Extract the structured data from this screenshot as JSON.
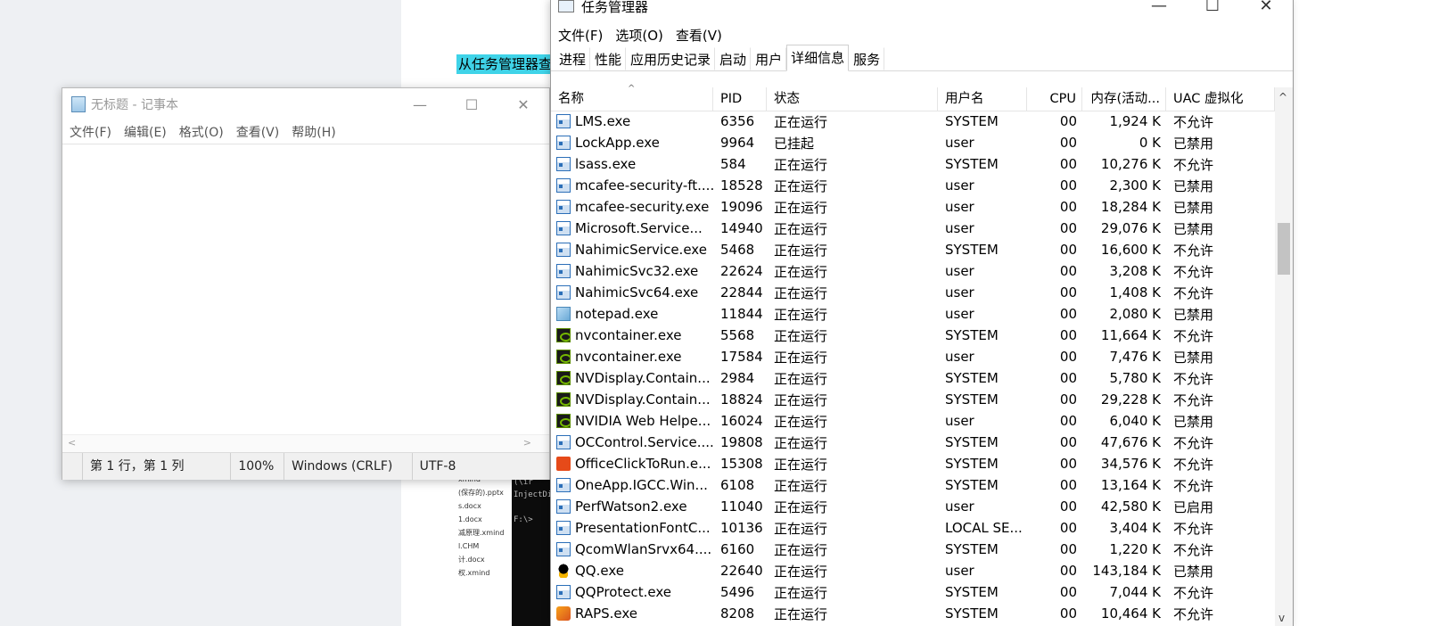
{
  "background": {
    "doc_highlight": "从任务管理器查",
    "files": [
      "xmind",
      "(保存的).pptx",
      "s.docx",
      "1.docx",
      "减原理.xmind",
      "l.CHM",
      "计.docx",
      "权.xmind"
    ],
    "console_lines": [
      "(\\ir",
      "InjectDi",
      "",
      "F:\\>"
    ]
  },
  "notepad": {
    "title": "无标题 - 记事本",
    "menu": [
      "文件(F)",
      "编辑(E)",
      "格式(O)",
      "查看(V)",
      "帮助(H)"
    ],
    "status": {
      "position": "第 1 行，第 1 列",
      "zoom": "100%",
      "line_ending": "Windows (CRLF)",
      "encoding": "UTF-8"
    }
  },
  "taskmgr": {
    "title": "任务管理器",
    "menu": [
      "文件(F)",
      "选项(O)",
      "查看(V)"
    ],
    "tabs": [
      "进程",
      "性能",
      "应用历史记录",
      "启动",
      "用户",
      "详细信息",
      "服务"
    ],
    "active_tab": "详细信息",
    "columns": {
      "name": "名称",
      "pid": "PID",
      "status": "状态",
      "user": "用户名",
      "cpu": "CPU",
      "mem": "内存(活动...",
      "uac": "UAC 虚拟化"
    },
    "rows": [
      {
        "icon": "exe",
        "name": "LMS.exe",
        "pid": "6356",
        "status": "正在运行",
        "user": "SYSTEM",
        "cpu": "00",
        "mem": "1,924 K",
        "uac": "不允许"
      },
      {
        "icon": "exe",
        "name": "LockApp.exe",
        "pid": "9964",
        "status": "已挂起",
        "user": "user",
        "cpu": "00",
        "mem": "0 K",
        "uac": "已禁用"
      },
      {
        "icon": "exe",
        "name": "lsass.exe",
        "pid": "584",
        "status": "正在运行",
        "user": "SYSTEM",
        "cpu": "00",
        "mem": "10,276 K",
        "uac": "不允许"
      },
      {
        "icon": "exe",
        "name": "mcafee-security-ft....",
        "pid": "18528",
        "status": "正在运行",
        "user": "user",
        "cpu": "00",
        "mem": "2,300 K",
        "uac": "已禁用"
      },
      {
        "icon": "exe",
        "name": "mcafee-security.exe",
        "pid": "19096",
        "status": "正在运行",
        "user": "user",
        "cpu": "00",
        "mem": "18,284 K",
        "uac": "已禁用"
      },
      {
        "icon": "exe",
        "name": "Microsoft.Service...",
        "pid": "14940",
        "status": "正在运行",
        "user": "user",
        "cpu": "00",
        "mem": "29,076 K",
        "uac": "已禁用"
      },
      {
        "icon": "exe",
        "name": "NahimicService.exe",
        "pid": "5468",
        "status": "正在运行",
        "user": "SYSTEM",
        "cpu": "00",
        "mem": "16,600 K",
        "uac": "不允许"
      },
      {
        "icon": "exe",
        "name": "NahimicSvc32.exe",
        "pid": "22624",
        "status": "正在运行",
        "user": "user",
        "cpu": "00",
        "mem": "3,208 K",
        "uac": "不允许"
      },
      {
        "icon": "exe",
        "name": "NahimicSvc64.exe",
        "pid": "22844",
        "status": "正在运行",
        "user": "user",
        "cpu": "00",
        "mem": "1,408 K",
        "uac": "不允许"
      },
      {
        "icon": "note",
        "name": "notepad.exe",
        "pid": "11844",
        "status": "正在运行",
        "user": "user",
        "cpu": "00",
        "mem": "2,080 K",
        "uac": "已禁用"
      },
      {
        "icon": "nv",
        "name": "nvcontainer.exe",
        "pid": "5568",
        "status": "正在运行",
        "user": "SYSTEM",
        "cpu": "00",
        "mem": "11,664 K",
        "uac": "不允许"
      },
      {
        "icon": "nv",
        "name": "nvcontainer.exe",
        "pid": "17584",
        "status": "正在运行",
        "user": "user",
        "cpu": "00",
        "mem": "7,476 K",
        "uac": "已禁用"
      },
      {
        "icon": "nv",
        "name": "NVDisplay.Contain...",
        "pid": "2984",
        "status": "正在运行",
        "user": "SYSTEM",
        "cpu": "00",
        "mem": "5,780 K",
        "uac": "不允许"
      },
      {
        "icon": "nv",
        "name": "NVDisplay.Contain...",
        "pid": "18824",
        "status": "正在运行",
        "user": "SYSTEM",
        "cpu": "00",
        "mem": "29,228 K",
        "uac": "不允许"
      },
      {
        "icon": "nv",
        "name": "NVIDIA Web Helpe...",
        "pid": "16024",
        "status": "正在运行",
        "user": "user",
        "cpu": "00",
        "mem": "6,040 K",
        "uac": "已禁用"
      },
      {
        "icon": "exe",
        "name": "OCControl.Service....",
        "pid": "19808",
        "status": "正在运行",
        "user": "SYSTEM",
        "cpu": "00",
        "mem": "47,676 K",
        "uac": "不允许"
      },
      {
        "icon": "office",
        "name": "OfficeClickToRun.e...",
        "pid": "15308",
        "status": "正在运行",
        "user": "SYSTEM",
        "cpu": "00",
        "mem": "34,576 K",
        "uac": "不允许"
      },
      {
        "icon": "exe",
        "name": "OneApp.IGCC.Win...",
        "pid": "6108",
        "status": "正在运行",
        "user": "SYSTEM",
        "cpu": "00",
        "mem": "13,164 K",
        "uac": "不允许"
      },
      {
        "icon": "exe",
        "name": "PerfWatson2.exe",
        "pid": "11040",
        "status": "正在运行",
        "user": "user",
        "cpu": "00",
        "mem": "42,580 K",
        "uac": "已启用"
      },
      {
        "icon": "exe",
        "name": "PresentationFontC...",
        "pid": "10136",
        "status": "正在运行",
        "user": "LOCAL SE...",
        "cpu": "00",
        "mem": "3,404 K",
        "uac": "不允许"
      },
      {
        "icon": "exe",
        "name": "QcomWlanSrvx64....",
        "pid": "6160",
        "status": "正在运行",
        "user": "SYSTEM",
        "cpu": "00",
        "mem": "1,220 K",
        "uac": "不允许"
      },
      {
        "icon": "qq",
        "name": "QQ.exe",
        "pid": "22640",
        "status": "正在运行",
        "user": "user",
        "cpu": "00",
        "mem": "143,184 K",
        "uac": "已禁用"
      },
      {
        "icon": "exe",
        "name": "QQProtect.exe",
        "pid": "5496",
        "status": "正在运行",
        "user": "SYSTEM",
        "cpu": "00",
        "mem": "7,044 K",
        "uac": "不允许"
      },
      {
        "icon": "raps",
        "name": "RAPS.exe",
        "pid": "8208",
        "status": "正在运行",
        "user": "SYSTEM",
        "cpu": "00",
        "mem": "10,464 K",
        "uac": "不允许"
      }
    ]
  }
}
